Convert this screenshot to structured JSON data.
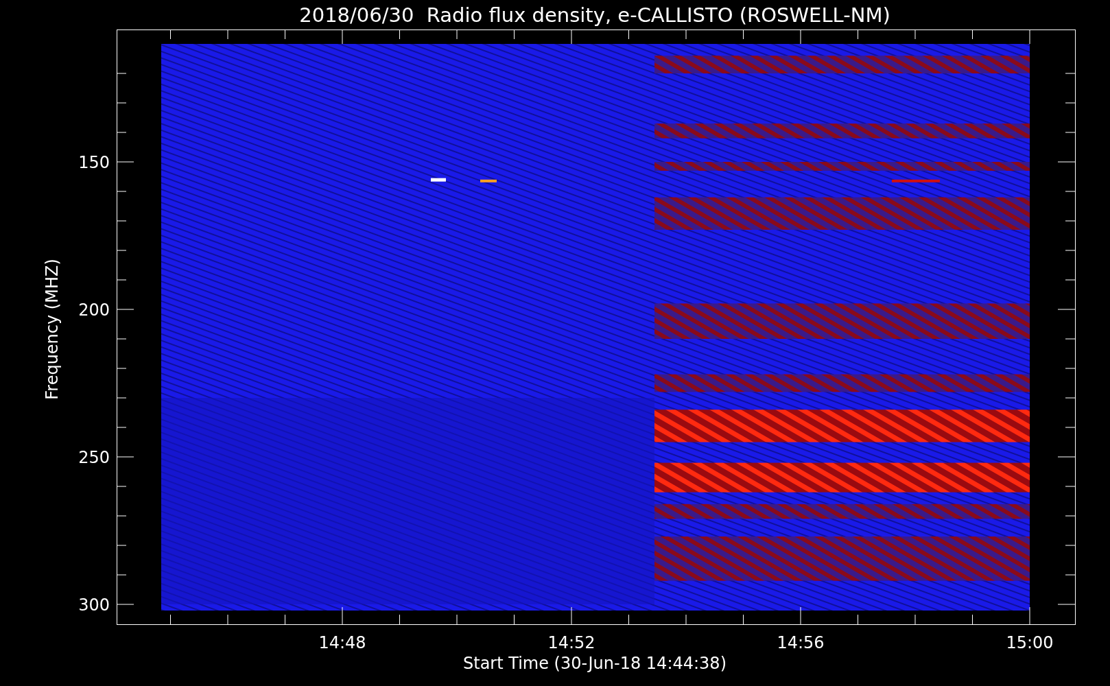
{
  "title": "2018/06/30  Radio flux density, e-CALLISTO (ROSWELL-NM)",
  "x_axis": {
    "label": "Start Time (30-Jun-18 14:44:38)",
    "ticks": [
      "14:48",
      "14:52",
      "14:56",
      "15:00"
    ]
  },
  "y_axis": {
    "label": "Frequency (MHZ)",
    "ticks": [
      "150",
      "200",
      "250",
      "300"
    ]
  }
}
